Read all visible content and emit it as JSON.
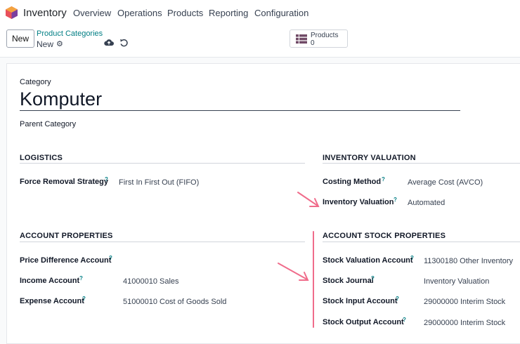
{
  "nav": {
    "app_title": "Inventory",
    "menu": [
      "Overview",
      "Operations",
      "Products",
      "Reporting",
      "Configuration"
    ]
  },
  "control_panel": {
    "new_label": "New",
    "breadcrumb": "Product Categories",
    "record_name": "New",
    "smart_button": {
      "label": "Products",
      "count": "0"
    }
  },
  "form": {
    "category_label": "Category",
    "category_name": "Komputer",
    "parent_category_label": "Parent Category",
    "logistics": {
      "title": "LOGISTICS",
      "force_removal_label": "Force Removal Strategy",
      "force_removal_value": "First In First Out (FIFO)"
    },
    "inventory_valuation": {
      "title": "INVENTORY VALUATION",
      "costing_method_label": "Costing Method",
      "costing_method_value": "Average Cost (AVCO)",
      "valuation_label": "Inventory Valuation",
      "valuation_value": "Automated"
    },
    "account_properties": {
      "title": "ACCOUNT PROPERTIES",
      "price_diff_label": "Price Difference Account",
      "income_label": "Income Account",
      "income_value": "41000010 Sales",
      "expense_label": "Expense Account",
      "expense_value": "51000010 Cost of Goods Sold"
    },
    "account_stock_properties": {
      "title": "ACCOUNT STOCK PROPERTIES",
      "stock_valuation_label": "Stock Valuation Account",
      "stock_valuation_value": "11300180 Other Inventory",
      "stock_journal_label": "Stock Journal",
      "stock_journal_value": "Inventory Valuation",
      "stock_input_label": "Stock Input Account",
      "stock_input_value": "29000000 Interim Stock",
      "stock_output_label": "Stock Output Account",
      "stock_output_value": "29000000 Interim Stock"
    },
    "help_marker": "?"
  },
  "colors": {
    "brand_teal": "#017e84",
    "annotation_pink": "#f06c8b"
  }
}
